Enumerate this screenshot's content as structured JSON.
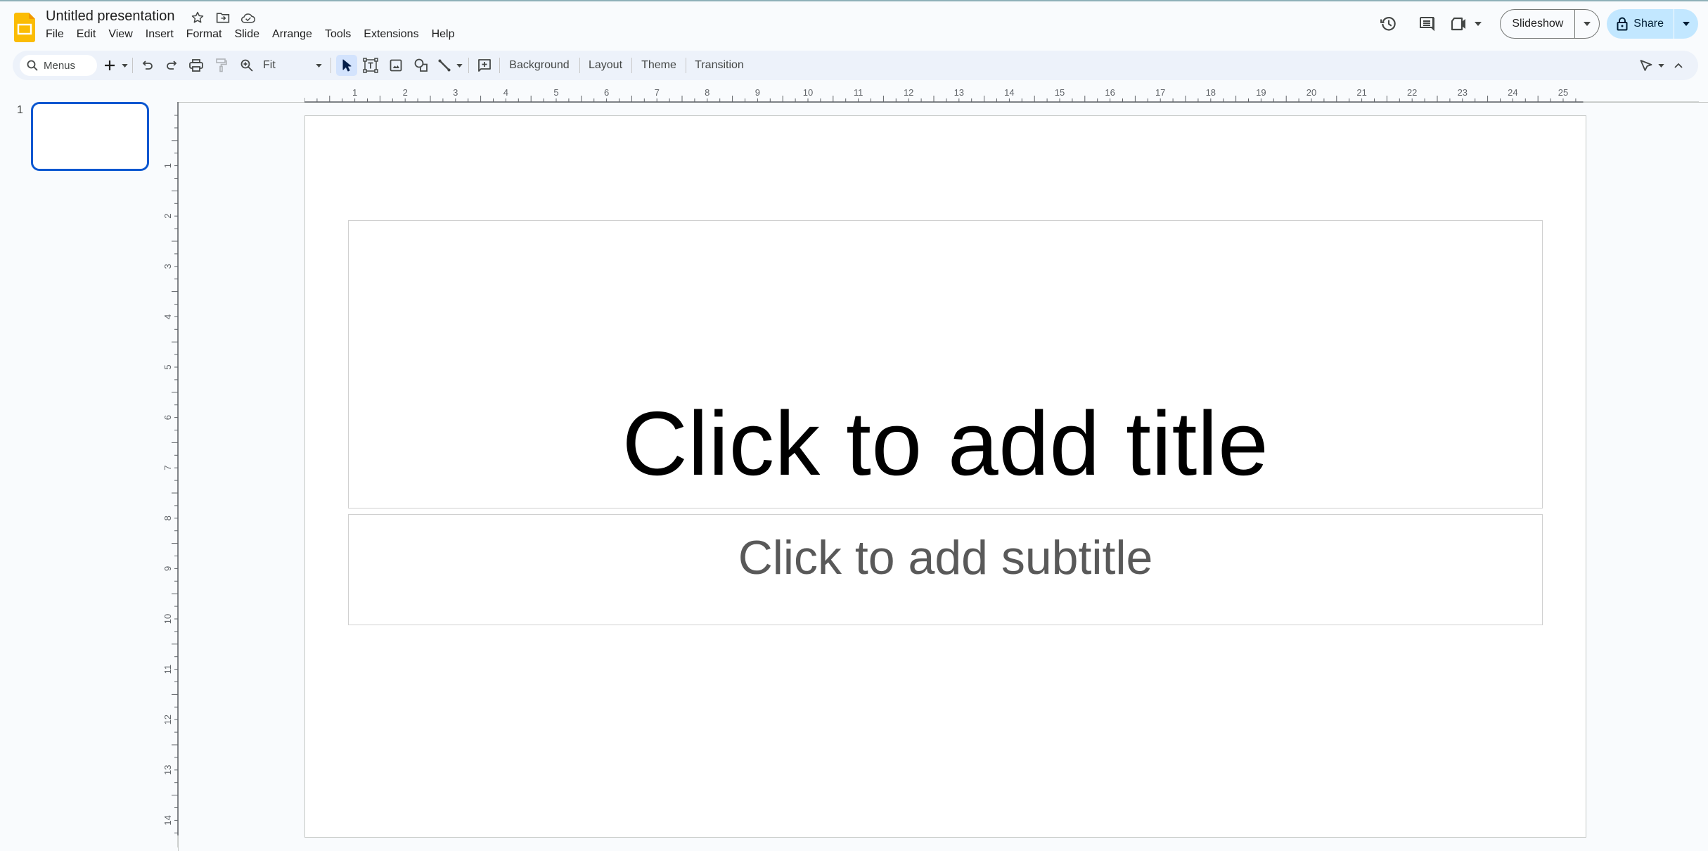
{
  "app": {
    "doc_title": "Untitled presentation",
    "accent_color": "#0b57d0",
    "share_bg_color": "#c2e7ff"
  },
  "header": {
    "title_icons": [
      "star-icon",
      "move-to-folder-icon",
      "cloud-saved-icon"
    ],
    "menu": [
      "File",
      "Edit",
      "View",
      "Insert",
      "Format",
      "Slide",
      "Arrange",
      "Tools",
      "Extensions",
      "Help"
    ],
    "right_icons": [
      "version-history-icon",
      "comments-icon",
      "meet-camera-icon"
    ],
    "slideshow_label": "Slideshow",
    "share_label": "Share"
  },
  "toolbar": {
    "search_label": "Menus",
    "zoom_value": "Fit",
    "background_label": "Background",
    "layout_label": "Layout",
    "theme_label": "Theme",
    "transition_label": "Transition"
  },
  "rulers": {
    "horizontal_labels": [
      "1",
      "2",
      "3",
      "4",
      "5",
      "6",
      "7",
      "8",
      "9",
      "10",
      "11",
      "12",
      "13",
      "14",
      "15",
      "16",
      "17",
      "18",
      "19",
      "20",
      "21",
      "22",
      "23",
      "24",
      "25"
    ],
    "vertical_labels": [
      "1",
      "2",
      "3",
      "4",
      "5",
      "6",
      "7",
      "8",
      "9",
      "10",
      "11",
      "12",
      "13",
      "14"
    ]
  },
  "filmstrip": {
    "slides": [
      {
        "number": "1",
        "selected": true
      }
    ]
  },
  "slide": {
    "title_placeholder": "Click to add title",
    "subtitle_placeholder": "Click to add subtitle"
  }
}
